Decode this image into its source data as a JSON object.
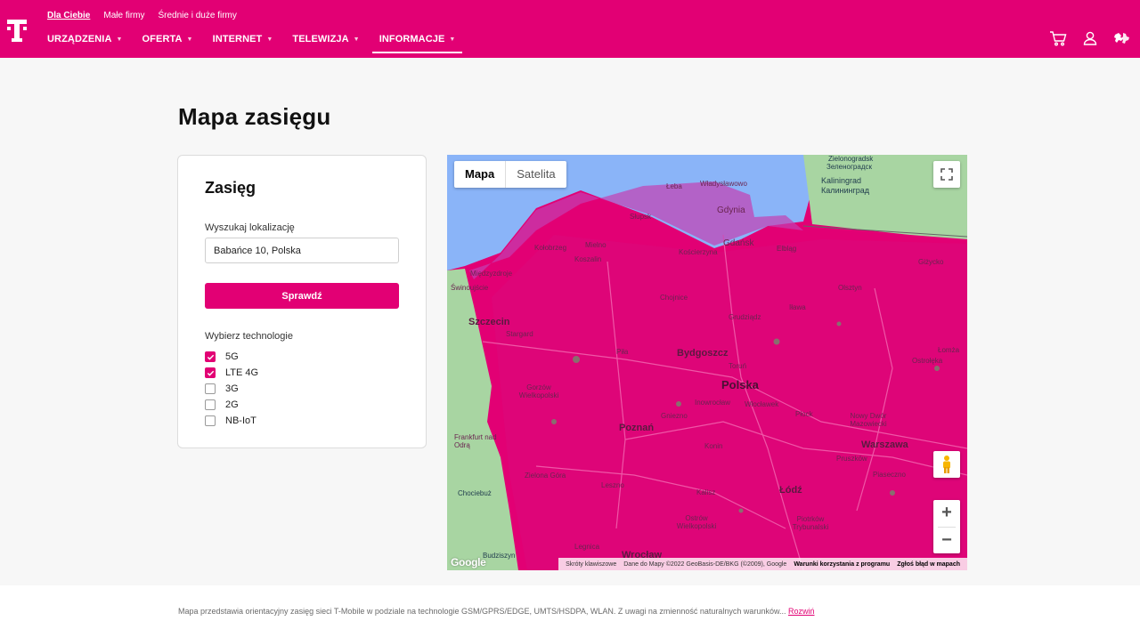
{
  "header": {
    "segments": [
      {
        "label": "Dla Ciebie",
        "active": true
      },
      {
        "label": "Małe firmy",
        "active": false
      },
      {
        "label": "Średnie i duże firmy",
        "active": false
      }
    ],
    "nav": [
      {
        "label": "URZĄDZENIA",
        "active": false
      },
      {
        "label": "OFERTA",
        "active": false
      },
      {
        "label": "INTERNET",
        "active": false
      },
      {
        "label": "TELEWIZJA",
        "active": false
      },
      {
        "label": "INFORMACJE",
        "active": true
      }
    ],
    "icons": [
      "cart-icon",
      "user-icon",
      "sign-language-icon"
    ],
    "brand_color": "#e20074"
  },
  "page": {
    "title": "Mapa zasięgu"
  },
  "panel": {
    "heading": "Zasięg",
    "search_label": "Wyszukaj lokalizację",
    "search_value": "Babańce 10, Polska",
    "button_label": "Sprawdź",
    "tech_label": "Wybierz technologie",
    "technologies": [
      {
        "label": "5G",
        "checked": true
      },
      {
        "label": "LTE 4G",
        "checked": true
      },
      {
        "label": "3G",
        "checked": false
      },
      {
        "label": "2G",
        "checked": false
      },
      {
        "label": "NB-IoT",
        "checked": false
      }
    ]
  },
  "map": {
    "type_options": [
      "Mapa",
      "Satelita"
    ],
    "selected_type": "Mapa",
    "zoom_in": "+",
    "zoom_out": "−",
    "google_logo": "Google",
    "footer": {
      "shortcuts": "Skróty klawiszowe",
      "data": "Dane do Mapy ©2022 GeoBasis-DE/BKG (©2009), Google",
      "terms": "Warunki korzystania z programu",
      "report": "Zgłoś błąd w mapach"
    },
    "places": [
      "Zielonogradsk",
      "Зеленоградск",
      "Kaliningrad",
      "Калининград",
      "Łeba",
      "Władysławowo",
      "Słupsk",
      "Gdynia",
      "Gdańsk",
      "Kołobrzeg",
      "Mielno",
      "Koszalin",
      "Kościerzyna",
      "Elbląg",
      "Międzyzdroje",
      "Świnoujście",
      "Giżycko",
      "Olsztyn",
      "Chojnice",
      "Szczecin",
      "Stargard",
      "Grudziądz",
      "Iława",
      "Piła",
      "Bydgoszcz",
      "Toruń",
      "Polska",
      "Gorzów Wielkopolski",
      "Inowrocław",
      "Włocławek",
      "Płock",
      "Gniezno",
      "Poznań",
      "Frankfurt nad Odrą",
      "Warszawa",
      "Konin",
      "Zielona Góra",
      "Leszno",
      "Kalisz",
      "Łódź",
      "Ostrów Wielkopolski",
      "Piotrków Trybunalski",
      "Legnica",
      "Wrocław",
      "Chociebuż",
      "Ostrołęka",
      "Nowy Dwór Mazowiecki",
      "Pruszków",
      "Piaseczno",
      "Łomża",
      "Budziszyn"
    ]
  },
  "footer": {
    "disclaimer": "Mapa przedstawia orientacyjny zasięg sieci T-Mobile w podziale na technologie GSM/GPRS/EDGE, UMTS/HSDPA, WLAN. Z uwagi na zmienność naturalnych warunków...",
    "expand_link": "Rozwiń"
  }
}
